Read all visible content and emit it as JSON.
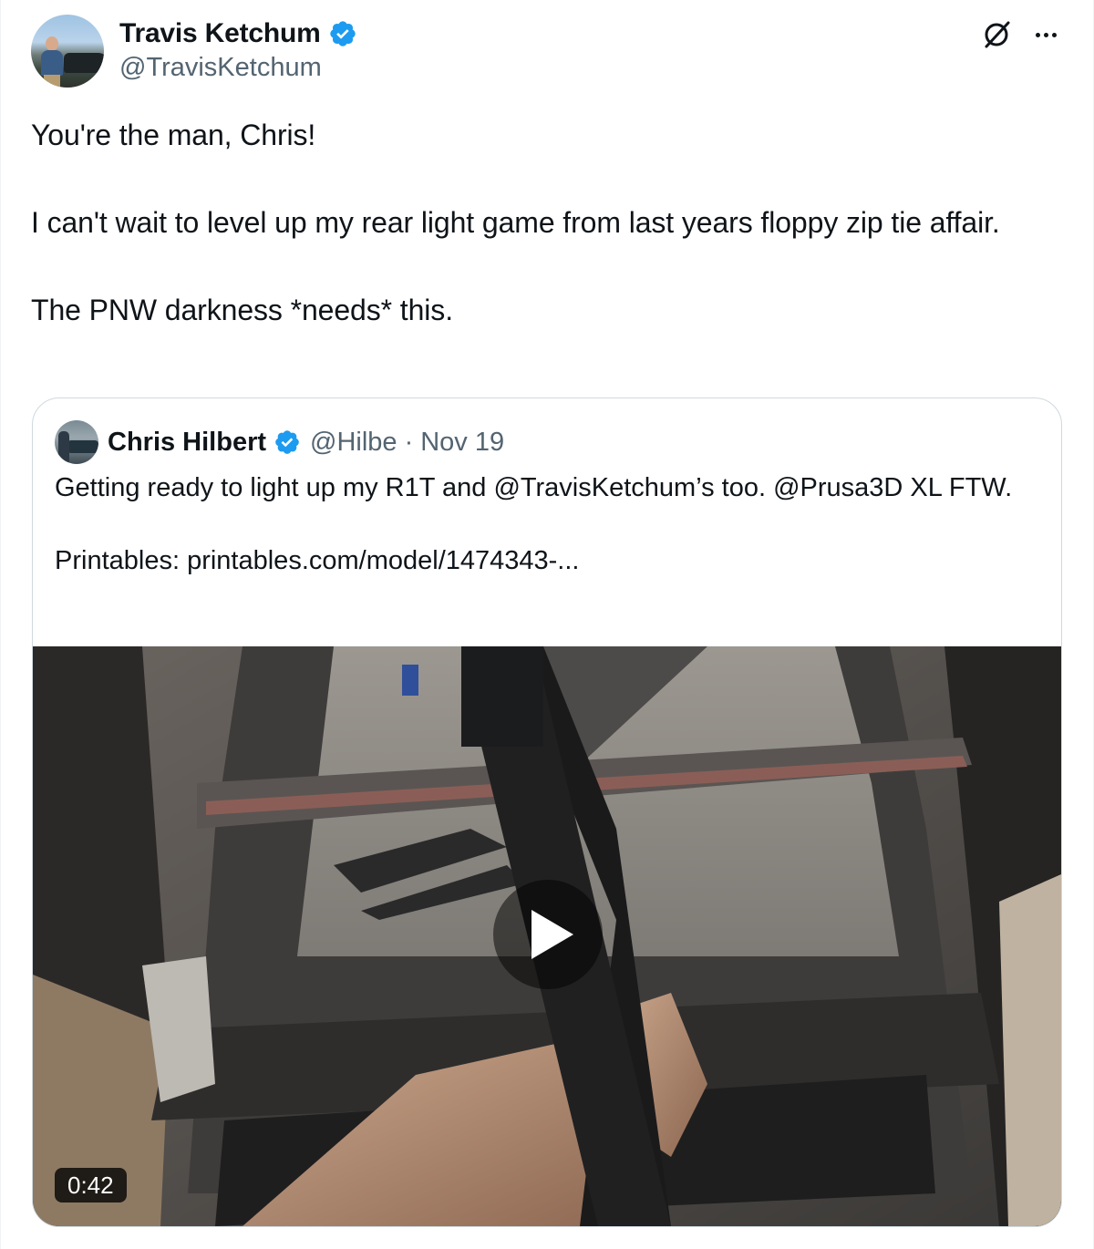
{
  "author": {
    "display_name": "Travis Ketchum",
    "handle": "@TravisKetchum",
    "verified": true
  },
  "tweet": {
    "paragraphs": [
      "You're the man, Chris!",
      "I can't wait to level up my rear light game from last years floppy zip tie affair.",
      "The PNW darkness *needs* this."
    ]
  },
  "quoted_tweet": {
    "display_name": "Chris Hilbert",
    "handle": "@Hilbe",
    "separator": "·",
    "date": "Nov 19",
    "verified": true,
    "paragraphs": [
      "Getting ready to light up my R1T and @TravisKetchum’s too.  @Prusa3D XL FTW.",
      "Printables:  printables.com/model/1474343-..."
    ],
    "video": {
      "duration": "0:42"
    }
  },
  "icons": {
    "verified": "verified-badge-icon",
    "grok": "grok-icon",
    "more": "more-options-icon",
    "play": "play-icon"
  },
  "colors": {
    "verified_blue": "#1d9bf0",
    "secondary_text": "#536471",
    "border": "#cfd9de"
  }
}
